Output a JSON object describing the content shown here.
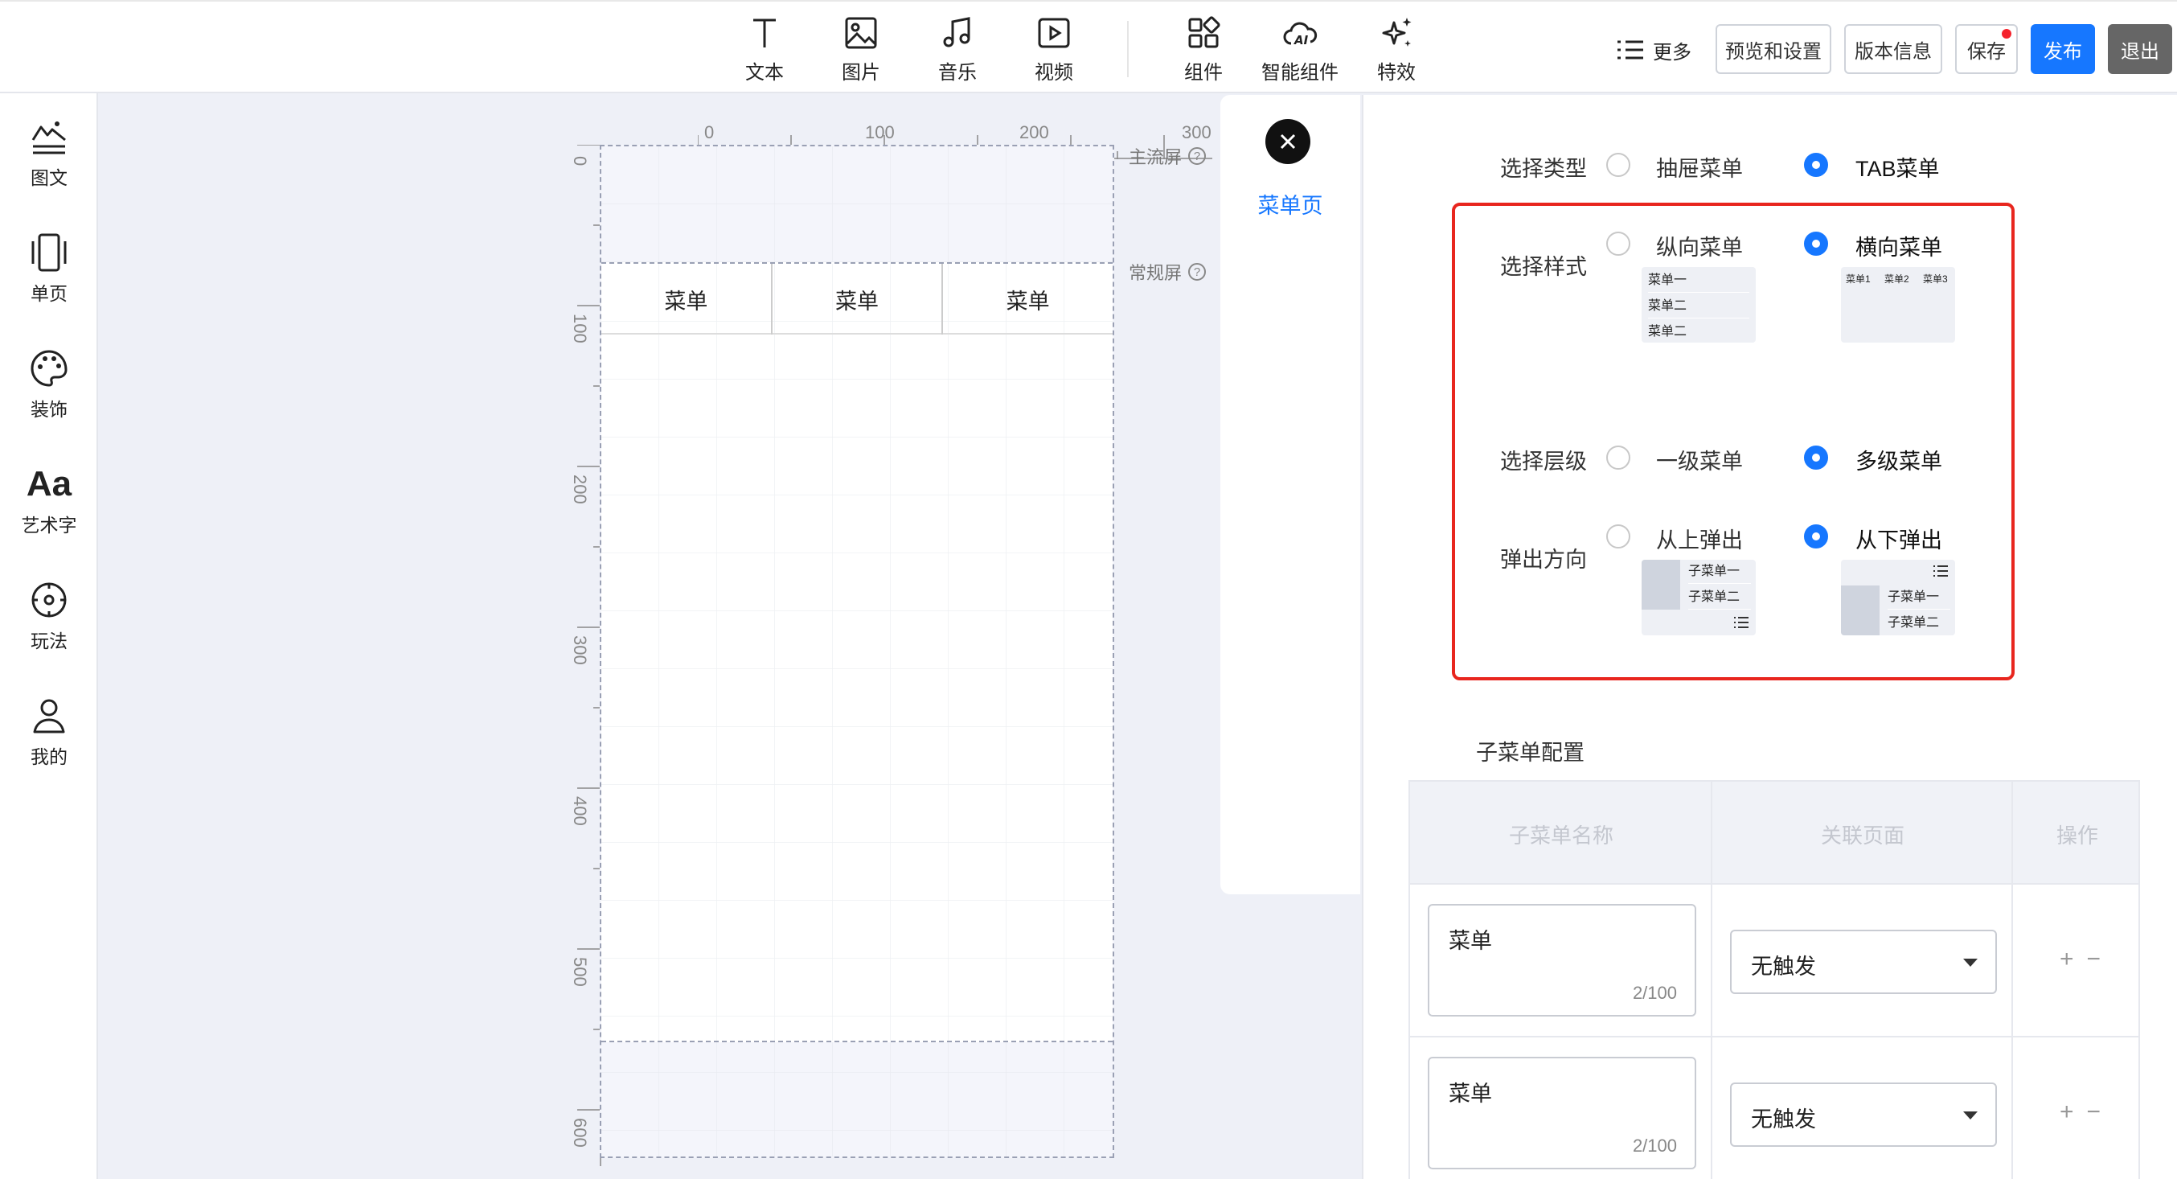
{
  "toolbar": {
    "tools": [
      {
        "label": "文本",
        "icon": "text-icon"
      },
      {
        "label": "图片",
        "icon": "image-icon"
      },
      {
        "label": "音乐",
        "icon": "music-icon"
      },
      {
        "label": "视频",
        "icon": "video-icon"
      },
      {
        "label": "组件",
        "icon": "components-icon"
      },
      {
        "label": "智能组件",
        "icon": "ai-cloud-icon"
      },
      {
        "label": "特效",
        "icon": "sparkle-icon"
      }
    ],
    "more_label": "更多",
    "preview_label": "预览和设置",
    "version_label": "版本信息",
    "save_label": "保存",
    "publish_label": "发布",
    "exit_label": "退出"
  },
  "sidebar": {
    "items": [
      {
        "label": "图文",
        "icon": "graphic-text-icon"
      },
      {
        "label": "单页",
        "icon": "single-page-icon"
      },
      {
        "label": "装饰",
        "icon": "palette-icon"
      },
      {
        "label": "艺术字",
        "icon": "art-text-icon",
        "glyph": "Aa"
      },
      {
        "label": "玩法",
        "icon": "gameplay-icon"
      },
      {
        "label": "我的",
        "icon": "user-icon"
      }
    ]
  },
  "canvas": {
    "ruler_h": [
      "0",
      "100",
      "200",
      "300"
    ],
    "ruler_v": [
      "0",
      "100",
      "200",
      "300",
      "400",
      "500",
      "600"
    ],
    "main_screen_label": "主流屏",
    "normal_screen_label": "常规屏",
    "help_glyph": "?",
    "tabs": [
      "菜单",
      "菜单",
      "菜单"
    ]
  },
  "float_panel": {
    "title": "菜单页"
  },
  "config": {
    "type_label": "选择类型",
    "type_options": [
      "抽屉菜单",
      "TAB菜单"
    ],
    "style_label": "选择样式",
    "style_options": [
      "纵向菜单",
      "横向菜单"
    ],
    "style_vertical_preview": [
      "菜单一",
      "菜单二",
      "菜单二"
    ],
    "style_horizontal_preview": [
      "菜单1",
      "菜单2",
      "菜单3"
    ],
    "level_label": "选择层级",
    "level_options": [
      "一级菜单",
      "多级菜单"
    ],
    "popup_label": "弹出方向",
    "popup_options": [
      "从上弹出",
      "从下弹出"
    ],
    "popup_preview": [
      "子菜单一",
      "子菜单二"
    ],
    "submenu_title": "子菜单配置",
    "table": {
      "headers": [
        "子菜单名称",
        "关联页面",
        "操作"
      ],
      "rows": [
        {
          "name": "菜单",
          "count": "2/100",
          "page": "无触发"
        },
        {
          "name": "菜单",
          "count": "2/100",
          "page": "无触发"
        }
      ],
      "add_glyph": "+",
      "remove_glyph": "−"
    },
    "accent_color": "#1677ff",
    "highlight_color": "#e8261e"
  }
}
